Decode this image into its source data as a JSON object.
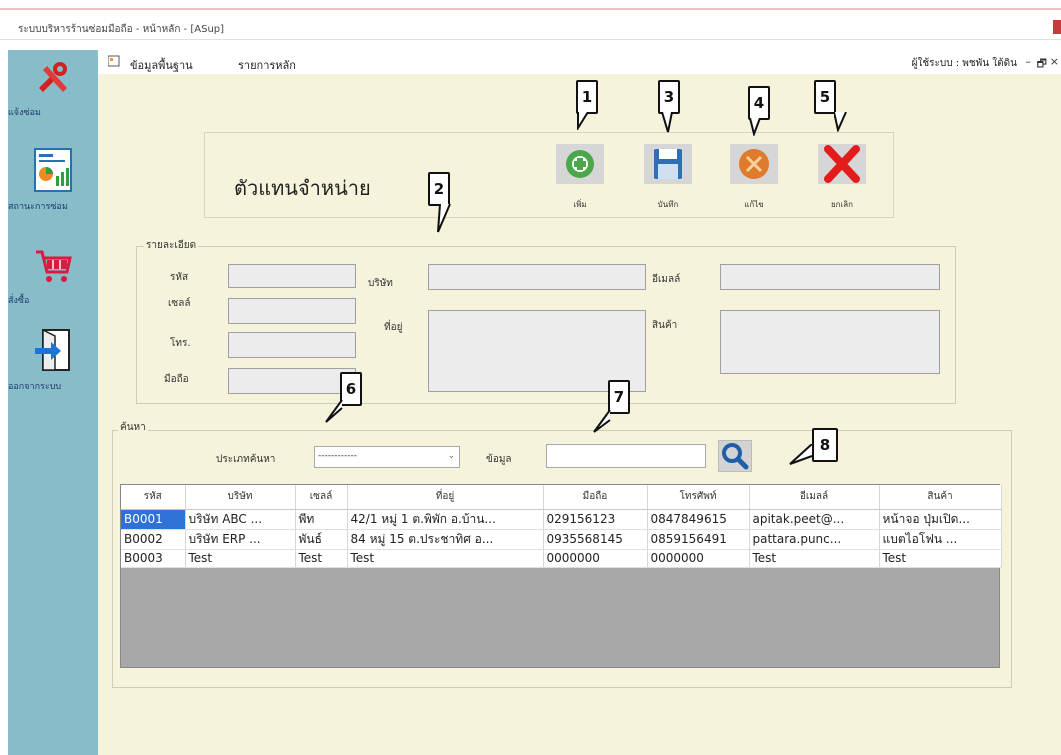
{
  "window": {
    "title": "ระบบบริหารร้านซ่อมมือถือ - หน้าหลัก - [ASup]"
  },
  "menu": {
    "items": [
      "ข้อมูลพื้นฐาน",
      "รายการหลัก"
    ],
    "user_info": "ผู้ใช้ระบบ : พชพัน ใต้ดิน",
    "minimize": "–",
    "restore": "🗗",
    "close": "×"
  },
  "sidebar": {
    "items": [
      {
        "label": "แจ้งซ่อม",
        "icon": "repair-tools-icon"
      },
      {
        "label": "สถานะการซ่อม",
        "icon": "status-report-icon"
      },
      {
        "label": "สั่งซื้อ",
        "icon": "shopping-cart-icon"
      },
      {
        "label": "ออกจากระบบ",
        "icon": "logout-icon"
      }
    ]
  },
  "form": {
    "title": "ตัวแทนจำหน่าย"
  },
  "toolbar": {
    "add_label": "เพิ่ม",
    "save_label": "บันทึก",
    "edit_label": "แก้ไข",
    "cancel_label": "ยกเลิก"
  },
  "details": {
    "group_title": "รายละเอียด",
    "code_label": "รหัส",
    "sale_label": "เซลล์",
    "phone_label": "โทร.",
    "mobile_label": "มือถือ",
    "company_label": "บริษัท",
    "address_label": "ที่อยู่",
    "email_label": "อีเมลล์",
    "product_label": "สินค้า"
  },
  "search": {
    "group_title": "ค้นหา",
    "type_label": "ประเภทค้นหา",
    "type_value": "------------",
    "data_label": "ข้อมูล",
    "data_value": ""
  },
  "table": {
    "headers": [
      "รหัส",
      "บริษัท",
      "เซลล์",
      "ที่อยู่",
      "มือถือ",
      "โทรศัพท์",
      "อีเมลล์",
      "สินค้า"
    ],
    "rows": [
      [
        "B0001",
        "บริษัท ABC ...",
        "พีท",
        "42/1 หมู่ 1 ต.พิพัก อ.บ้าน...",
        "029156123",
        "0847849615",
        "apitak.peet@...",
        "หน้าจอ ปุ่มเปิด..."
      ],
      [
        "B0002",
        "บริษัท ERP ...",
        "พันธ์",
        "84 หมู่ 15 ต.ประชาทิศ อ...",
        "0935568145",
        "0859156491",
        "pattara.punc...",
        "แบตไอโฟน ..."
      ],
      [
        "B0003",
        "Test",
        "Test",
        "Test",
        "0000000",
        "0000000",
        "Test",
        "Test"
      ]
    ]
  },
  "callouts": [
    "1",
    "2",
    "3",
    "4",
    "5",
    "6",
    "7",
    "8"
  ],
  "colors": {
    "sidebar": "#86bdc9",
    "main_bg": "#f5f3db",
    "selection": "#2f71d4",
    "add_green": "#4aa84a",
    "save_blue": "#2f6fb5",
    "edit_orange": "#e07b2e",
    "cancel_red": "#e31b1b"
  }
}
